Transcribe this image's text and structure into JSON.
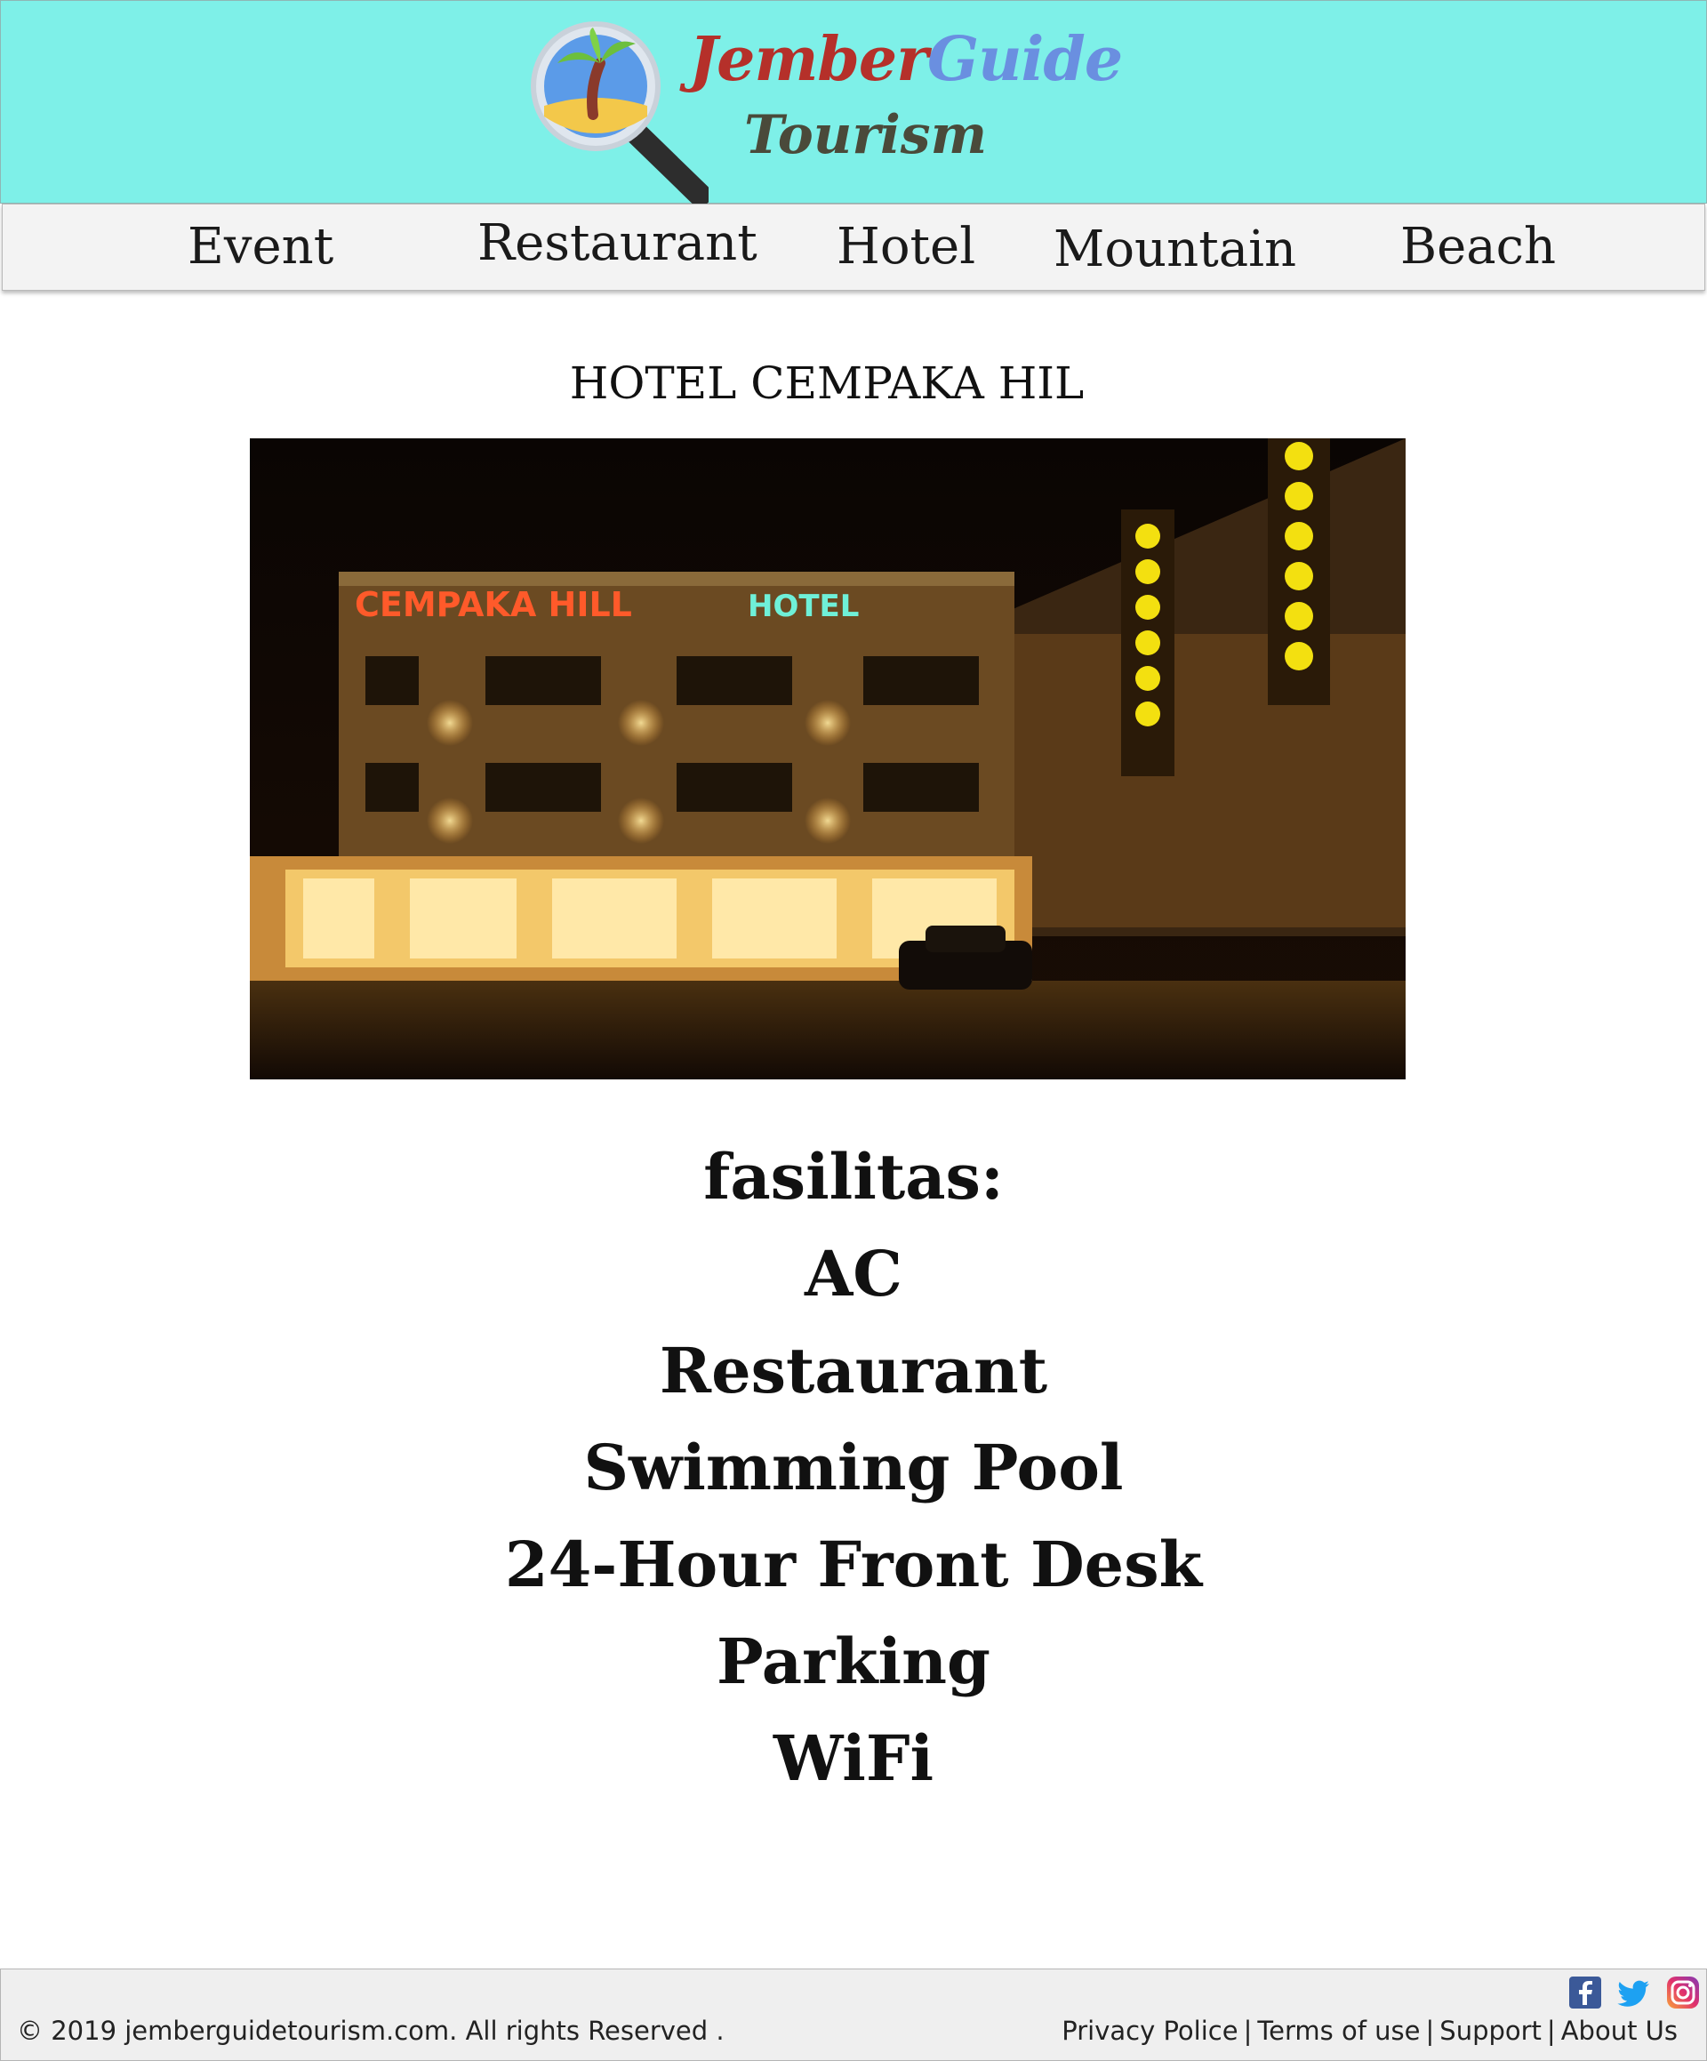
{
  "header": {
    "logo_title_part1": "Jember",
    "logo_title_part2": "Guide",
    "logo_subtitle": "Tourism"
  },
  "nav": {
    "items": [
      {
        "label": "Event"
      },
      {
        "label": "Restaurant"
      },
      {
        "label": "Hotel"
      },
      {
        "label": "Mountain"
      },
      {
        "label": "Beach"
      }
    ]
  },
  "main": {
    "hotel_title": "HOTEL CEMPAKA HIL",
    "photo_sign_name": "CEMPAKA HILL",
    "photo_sign_hotel": "HOTEL",
    "facilities_label": "fasilitas:",
    "facilities": [
      "AC",
      "Restaurant",
      "Swimming Pool",
      "24-Hour Front Desk",
      "Parking",
      "WiFi"
    ]
  },
  "footer": {
    "copyright": "© 2019 jemberguidetourism.com. All rights Reserved .",
    "links": [
      "Privacy Police",
      "Terms of use",
      "Support",
      "About Us"
    ],
    "social_icons": [
      "facebook-icon",
      "twitter-icon",
      "instagram-icon"
    ]
  },
  "colors": {
    "header_bg": "#7ef0e8",
    "nav_bg": "#f3f3f3",
    "footer_bg": "#efefef",
    "logo_red": "#b5302a",
    "logo_blue": "#6a8fe0"
  }
}
